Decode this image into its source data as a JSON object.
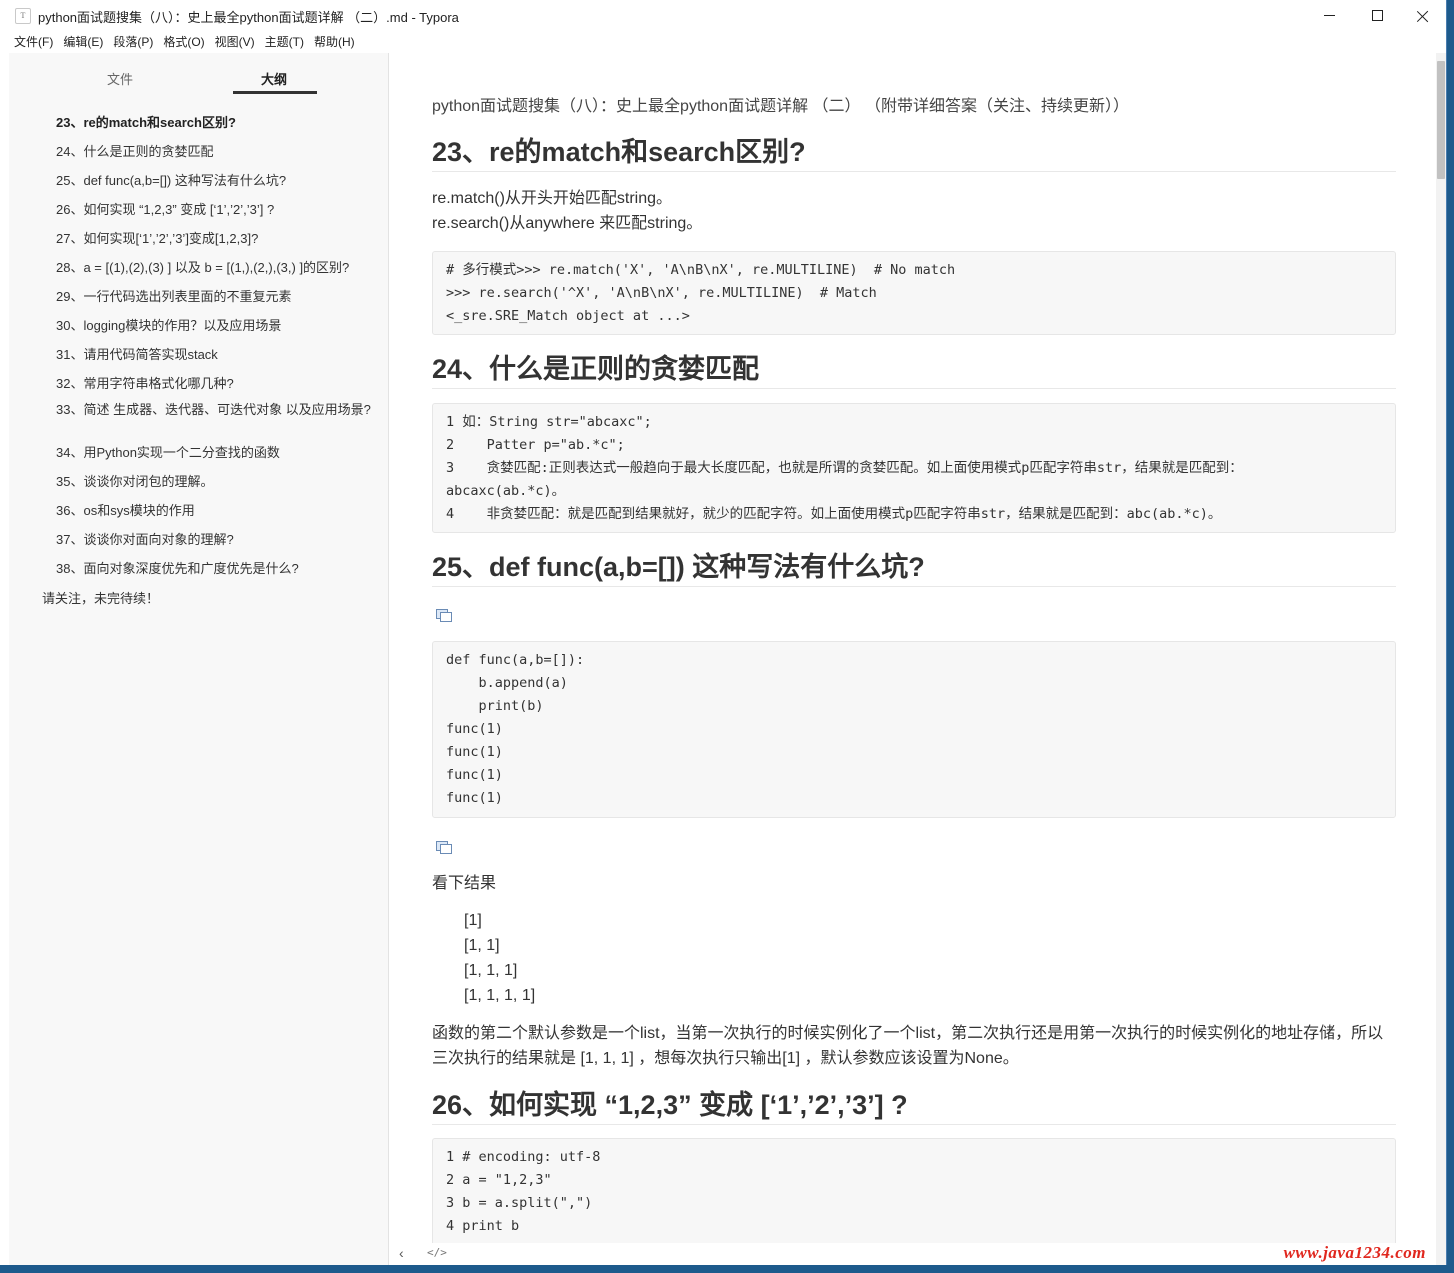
{
  "window": {
    "title": "python面试题搜集（八）：史上最全python面试题详解 （二）.md - Typora",
    "app_icon": "T"
  },
  "menu": [
    "文件(F)",
    "编辑(E)",
    "段落(P)",
    "格式(O)",
    "视图(V)",
    "主题(T)",
    "帮助(H)"
  ],
  "sidebar": {
    "tab_files": "文件",
    "tab_outline": "大纲",
    "outline": [
      "23、re的match和search区别?",
      "24、什么是正则的贪婪匹配",
      "25、def func(a,b=[]) 这种写法有什么坑?",
      "26、如何实现 “1,2,3” 变成 [‘1’,’2’,’3’] ?",
      "27、如何实现[‘1’,’2’,’3’]变成[1,2,3]?",
      "28、a = [(1),(2),(3) ] 以及 b = [(1,),(2,),(3,) ]的区别?",
      "29、一行代码选出列表里面的不重复元素",
      "30、logging模块的作用？以及应用场景",
      "31、请用代码简答实现stack",
      "32、常用字符串格式化哪几种?",
      "33、简述 生成器、迭代器、可迭代对象 以及应用场景?",
      "34、用Python实现一个二分查找的函数",
      "35、谈谈你对闭包的理解。",
      "36、os和sys模块的作用",
      "37、谈谈你对面向对象的理解?",
      "38、面向对象深度优先和广度优先是什么?"
    ],
    "outline_footer": "请关注，未完待续！"
  },
  "doc": {
    "title": "python面试题搜集（八）：史上最全python面试题详解 （二） （附带详细答案（关注、持续更新））",
    "h23": "23、re的match和search区别?",
    "p23_1": "re.match()从开头开始匹配string。",
    "p23_2": "re.search()从anywhere 来匹配string。",
    "code23": [
      "# 多行模式>>> re.match('X', 'A\\nB\\nX', re.MULTILINE)  # No match",
      ">>> re.search('^X', 'A\\nB\\nX', re.MULTILINE)  # Match",
      "<_sre.SRE_Match object at ...>"
    ],
    "h24": "24、什么是正则的贪婪匹配",
    "code24": [
      "1 如：String str=\"abcaxc\";",
      "2    Patter p=\"ab.*c\";",
      "3    贪婪匹配:正则表达式一般趋向于最大长度匹配，也就是所谓的贪婪匹配。如上面使用模式p匹配字符串str，结果就是匹配到：",
      "abcaxc(ab.*c)。",
      "4    非贪婪匹配：就是匹配到结果就好，就少的匹配字符。如上面使用模式p匹配字符串str，结果就是匹配到：abc(ab.*c)。"
    ],
    "h25": "25、def func(a,b=[]) 这种写法有什么坑?",
    "code25": [
      "def func(a,b=[]):",
      "    b.append(a)",
      "    print(b)",
      "func(1)",
      "func(1)",
      "func(1)",
      "func(1)"
    ],
    "p25_1": "看下结果",
    "results": [
      "[1]",
      "[1, 1]",
      "[1, 1, 1]",
      "[1, 1, 1, 1]"
    ],
    "p25_2": "函数的第二个默认参数是一个list，当第一次执行的时候实例化了一个list，第二次执行还是用第一次执行的时候实例化的地址存储，所以",
    "p25_3": "三次执行的结果就是 [1, 1, 1] ，想每次执行只输出[1] ，默认参数应该设置为None。",
    "h26": "26、如何实现 “1,2,3” 变成 [‘1’,’2’,’3’] ?",
    "code26": [
      "1 # encoding: utf-8",
      "2 a = \"1,2,3\"",
      "3 b = a.split(\",\")",
      "4 print b"
    ]
  },
  "bottom": {
    "back": "‹",
    "source_mode": "</>",
    "watermark": "www.java1234.com"
  }
}
